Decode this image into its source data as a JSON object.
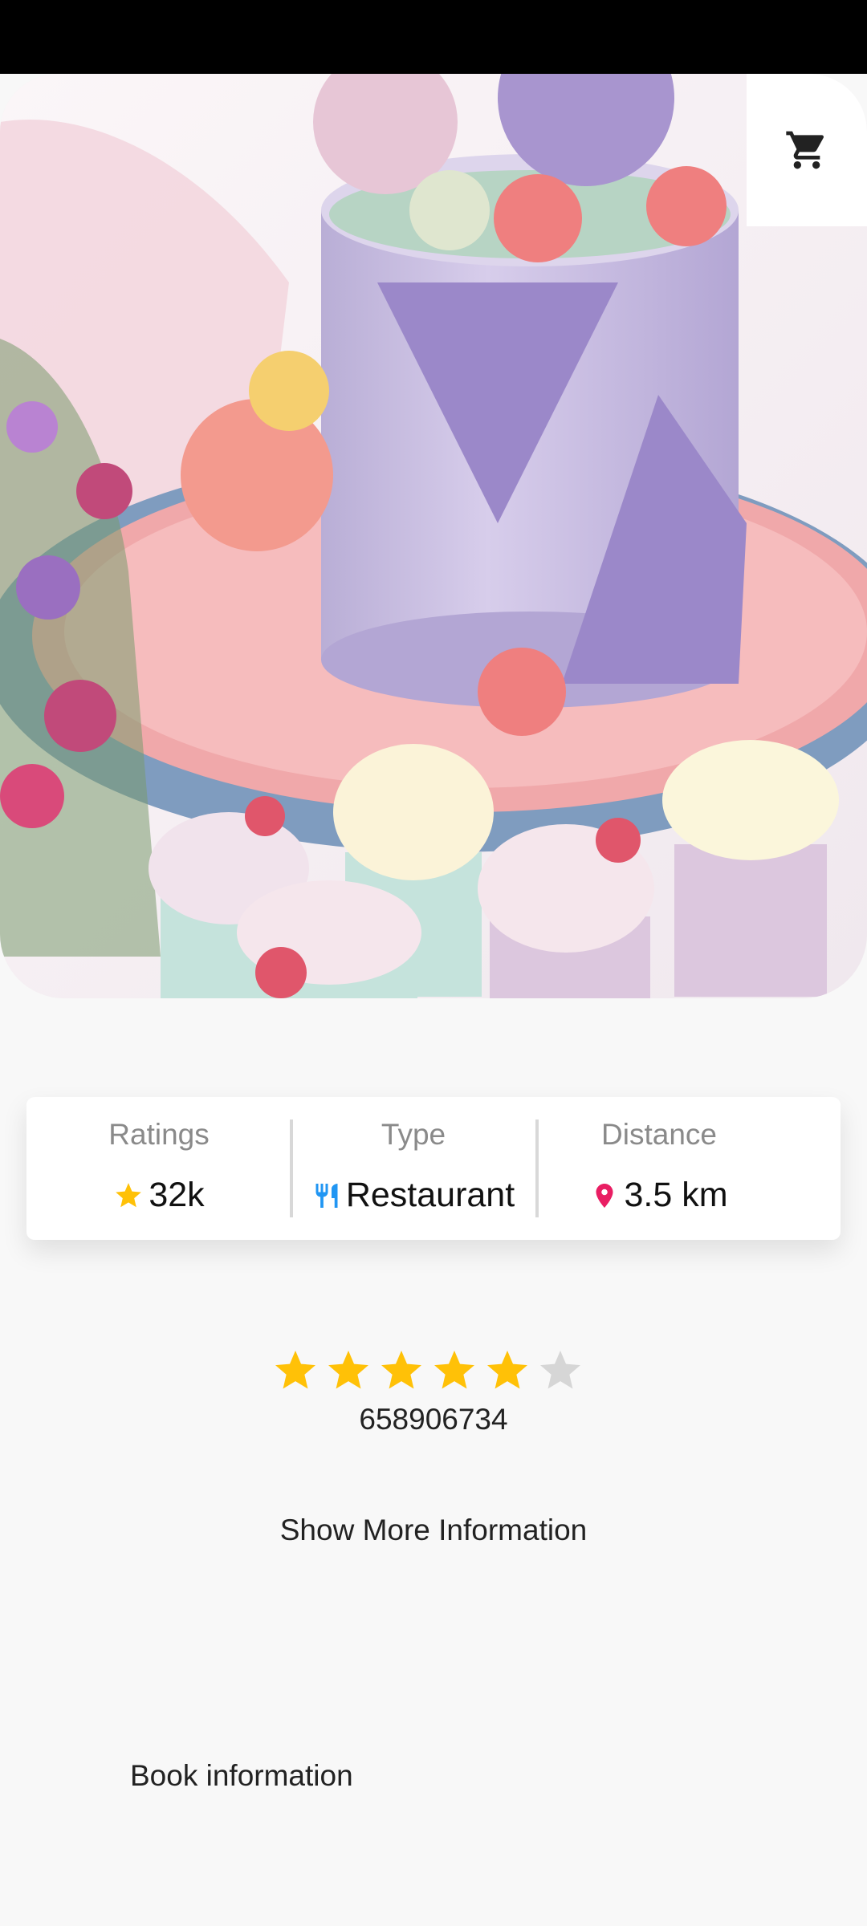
{
  "icons": {
    "cart": "cart-icon",
    "rating": "star-icon",
    "type": "restaurant-icon",
    "distance": "location-pin-icon"
  },
  "info": {
    "ratings_label": "Ratings",
    "ratings_value": "32k",
    "type_label": "Type",
    "type_value": "Restaurant",
    "distance_label": "Distance",
    "distance_value": "3.5 km"
  },
  "rating": {
    "stars_filled": 5,
    "stars_total": 6,
    "phone": "658906734"
  },
  "actions": {
    "show_more": "Show More Information",
    "book": "Book information"
  },
  "colors": {
    "star": "#FFC107",
    "star_empty": "#D6D6D6",
    "restaurant_icon": "#2196F3",
    "pin_icon": "#E91E63"
  }
}
